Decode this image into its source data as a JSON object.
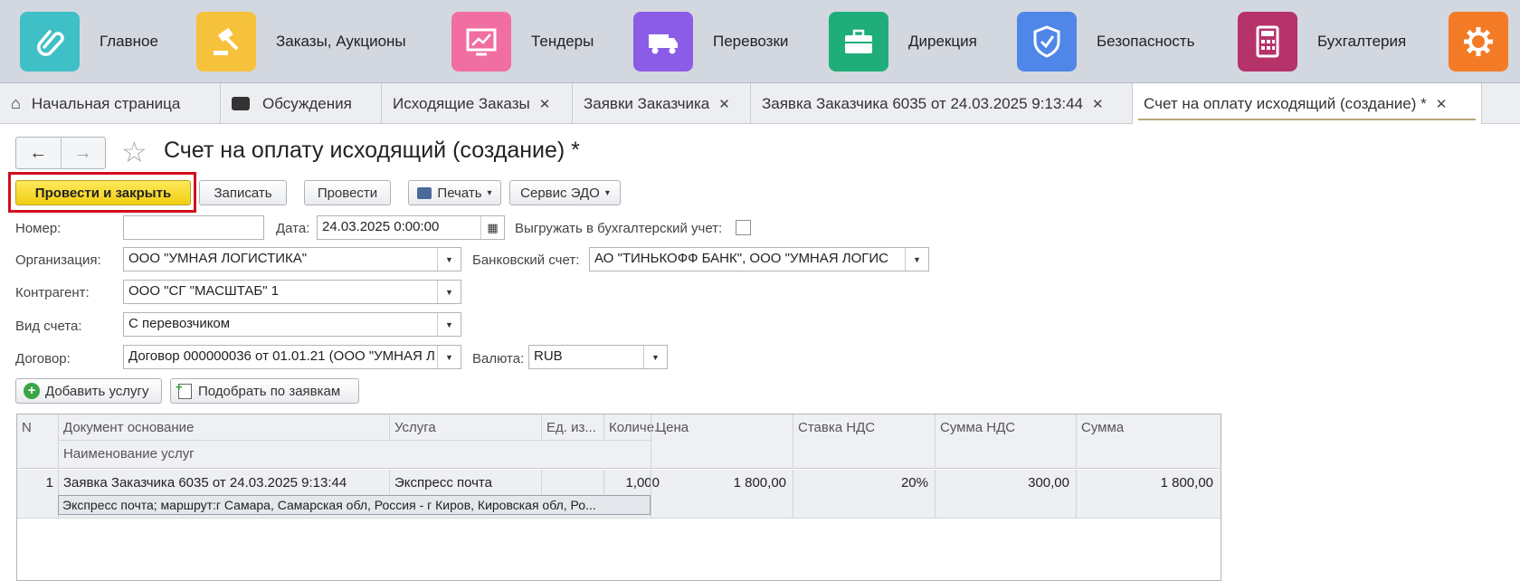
{
  "sections": [
    {
      "label": "Главное",
      "icon": "paperclip-icon",
      "color": "#3fc0c7"
    },
    {
      "label": "Заказы, Аукционы",
      "icon": "gavel-icon",
      "color": "#f7c23b"
    },
    {
      "label": "Тендеры",
      "icon": "chart-monitor-icon",
      "color": "#f06ea2"
    },
    {
      "label": "Перевозки",
      "icon": "truck-icon",
      "color": "#8b5ce6"
    },
    {
      "label": "Дирекция",
      "icon": "briefcase-icon",
      "color": "#1fae7a"
    },
    {
      "label": "Безопасность",
      "icon": "shield-check-icon",
      "color": "#4f86e8"
    },
    {
      "label": "Бухгалтерия",
      "icon": "calculator-icon",
      "color": "#b6336a"
    },
    {
      "label": "",
      "icon": "gear-icon",
      "color": "#f47b25"
    }
  ],
  "tabs": [
    {
      "label": "Начальная страница",
      "icon": "home-icon"
    },
    {
      "label": "Обсуждения",
      "icon": "chat-icon"
    },
    {
      "label": "Исходящие Заказы",
      "close": "✕"
    },
    {
      "label": "Заявки Заказчика",
      "close": "✕"
    },
    {
      "label": "Заявка Заказчика 6035 от 24.03.2025 9:13:44",
      "close": "✕"
    },
    {
      "label": "Счет на оплату исходящий (создание) *",
      "close": "✕"
    }
  ],
  "form": {
    "title": "Счет на оплату исходящий (создание) *",
    "buttons": {
      "post_close": "Провести и закрыть",
      "save": "Записать",
      "post": "Провести",
      "print": "Печать",
      "edo": "Сервис ЭДО"
    },
    "fields": {
      "number_label": "Номер:",
      "number_value": "",
      "date_label": "Дата:",
      "date_value": "24.03.2025  0:00:00",
      "export_label": "Выгружать в бухгалтерский учет:",
      "org_label": "Организация:",
      "org_value": "ООО \"УМНАЯ ЛОГИСТИКА\"",
      "bank_label": "Банковский счет:",
      "bank_value": "АО \"ТИНЬКОФФ БАНК\", ООО \"УМНАЯ ЛОГИС",
      "counterparty_label": "Контрагент:",
      "counterparty_value": "ООО \"СГ \"МАСШТАБ\" 1",
      "type_label": "Вид счета:",
      "type_value": "С перевозчиком",
      "contract_label": "Договор:",
      "contract_value": "Договор 000000036 от 01.01.21 (ООО \"УМНАЯ Л",
      "currency_label": "Валюта:",
      "currency_value": "RUB"
    },
    "table_buttons": {
      "add_service": "Добавить услугу",
      "pick_by_requests": "Подобрать по заявкам"
    },
    "table": {
      "headers": {
        "n": "N",
        "doc": "Документ основание",
        "service_name": "Наименование услуг",
        "service": "Услуга",
        "unit": "Ед. из...",
        "qty": "Количе...",
        "price": "Цена",
        "vat_rate": "Ставка НДС",
        "vat_sum": "Сумма НДС",
        "sum": "Сумма"
      },
      "rows": [
        {
          "n": "1",
          "doc": "Заявка Заказчика 6035 от 24.03.2025 9:13:44",
          "service": "Экспресс почта",
          "unit": "",
          "qty": "1,000",
          "price": "1 800,00",
          "vat_rate": "20%",
          "vat_sum": "300,00",
          "sum": "1 800,00",
          "service_name": "Экспресс почта; маршрут:г Самара, Самарская обл, Россия - г Киров, Кировская обл, Ро..."
        }
      ]
    }
  }
}
